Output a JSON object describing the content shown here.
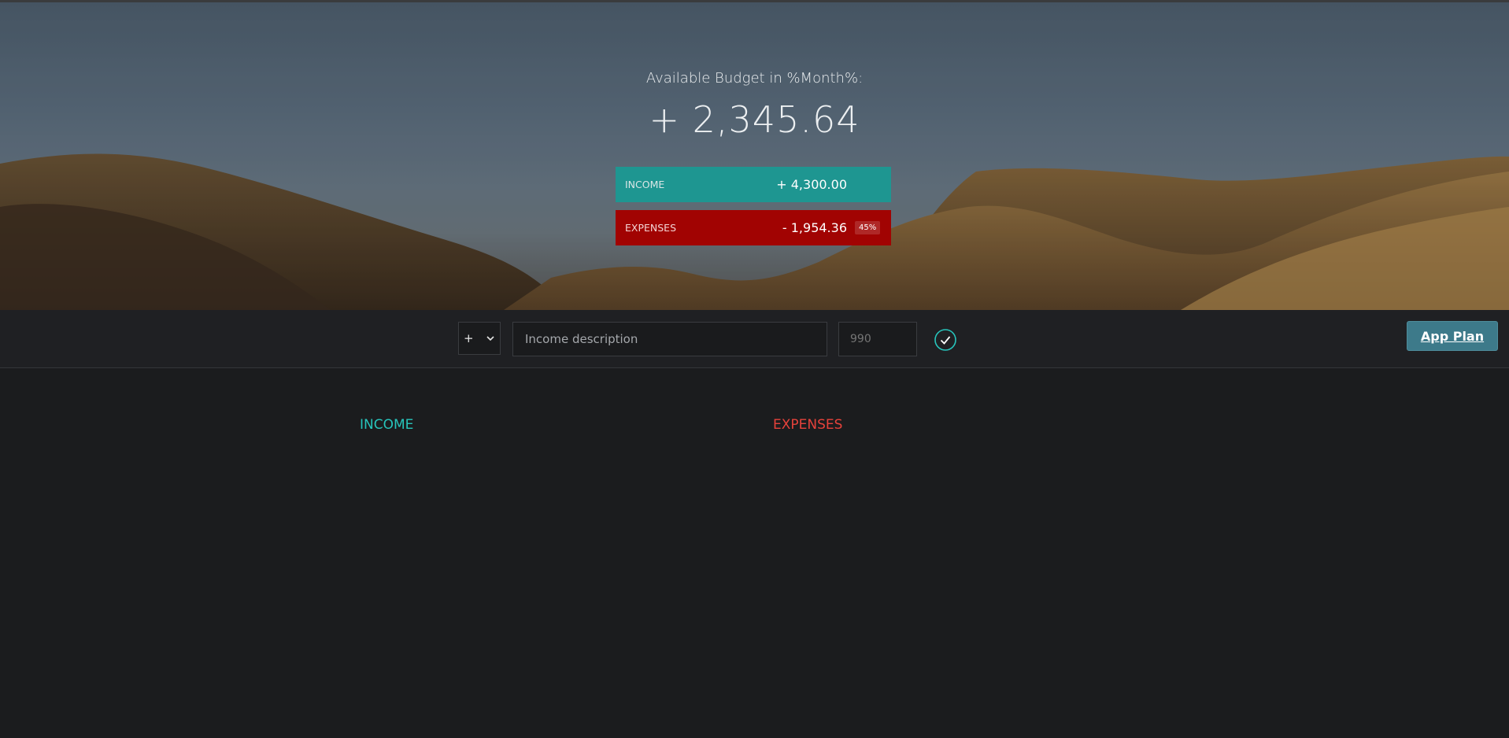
{
  "budget": {
    "title": "Available Budget in %Month%:",
    "value": "+ 2,345.64"
  },
  "summary": {
    "income": {
      "label": "INCOME",
      "value": "+ 4,300.00",
      "color": "#1e9691"
    },
    "expenses": {
      "label": "EXPENSES",
      "value": "- 1,954.36",
      "percentage": "45%",
      "color": "#a10302"
    }
  },
  "add_form": {
    "type_selected": "+",
    "description_placeholder": "Income description",
    "value_placeholder": "990",
    "submit_icon": "check-circle-icon",
    "accent": "#27c4bb"
  },
  "header_button": {
    "label": "App Plan"
  },
  "lists": {
    "income_title": "INCOME",
    "expenses_title": "EXPENSES",
    "income_color": "#27c4bb",
    "expenses_color": "#e6423b"
  }
}
